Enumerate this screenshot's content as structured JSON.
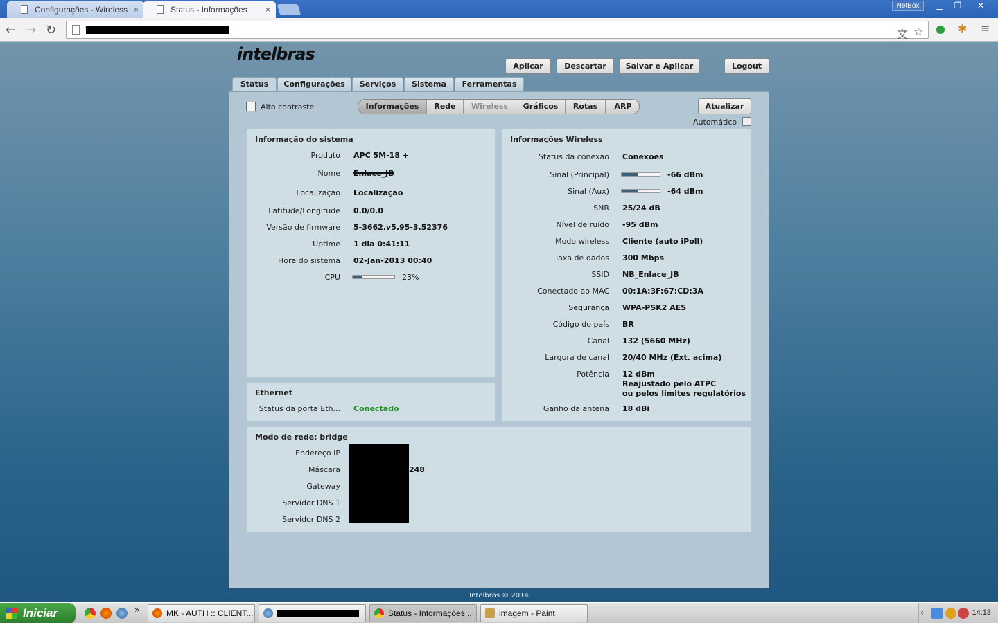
{
  "browser": {
    "tabs": [
      {
        "label": "Configurações - Wireless"
      },
      {
        "label": "Status - Informações"
      }
    ],
    "netbox": "NetBox",
    "url": "1",
    "close_glyph": "×"
  },
  "header": {
    "logo": "intelbras",
    "buttons": {
      "apply": "Aplicar",
      "discard": "Descartar",
      "save_apply": "Salvar e Aplicar",
      "logout": "Logout"
    }
  },
  "main_tabs": [
    "Status",
    "Configurações",
    "Serviços",
    "Sistema",
    "Ferramentas"
  ],
  "toolbar": {
    "high_contrast": "Alto contraste",
    "subtabs": [
      "Informações",
      "Rede",
      "Wireless",
      "Gráficos",
      "Rotas",
      "ARP"
    ],
    "refresh": "Atualizar",
    "automatic": "Automático"
  },
  "system": {
    "title": "Informação do sistema",
    "rows": [
      {
        "label": "Produto",
        "value": "APC 5M-18 +"
      },
      {
        "label": "Nome",
        "value": "Enlace_JB"
      },
      {
        "label": "Localização",
        "value": "Localização"
      },
      {
        "label": "Latitude/Longitude",
        "value": "0.0/0.0"
      },
      {
        "label": "Versão de firmware",
        "value": "5-3662.v5.95-3.52376"
      },
      {
        "label": "Uptime",
        "value": "1 dia 0:41:11"
      },
      {
        "label": "Hora do sistema",
        "value": "02-Jan-2013 00:40"
      },
      {
        "label": "CPU",
        "value": "23%"
      }
    ],
    "cpu_percent": 23
  },
  "ethernet": {
    "title": "Ethernet",
    "label": "Status da porta Eth...",
    "value": "Conectado"
  },
  "wireless": {
    "title": "Informações Wireless",
    "rows": [
      {
        "label": "Status da conexão",
        "value": "Conexões"
      },
      {
        "label": "Sinal (Principal)",
        "value": "-66 dBm"
      },
      {
        "label": "Sinal (Aux)",
        "value": "-64 dBm"
      },
      {
        "label": "SNR",
        "value": "25/24 dB"
      },
      {
        "label": "Nível de ruído",
        "value": "-95 dBm"
      },
      {
        "label": "Modo wireless",
        "value": "Cliente (auto iPoll)"
      },
      {
        "label": "Taxa de dados",
        "value": "300 Mbps"
      },
      {
        "label": "SSID",
        "value": "NB_Enlace_JB"
      },
      {
        "label": "Conectado ao MAC",
        "value": "00:1A:3F:67:CD:3A"
      },
      {
        "label": "Segurança",
        "value": "WPA-PSK2 AES"
      },
      {
        "label": "Código do país",
        "value": "BR"
      },
      {
        "label": "Canal",
        "value": "132 (5660 MHz)"
      },
      {
        "label": "Largura de canal",
        "value": "20/40 MHz (Ext. acima)"
      },
      {
        "label": "Potência",
        "value": "12 dBm",
        "value2": "Reajustado pelo ATPC",
        "value3": "ou pelos limites regulatórios"
      },
      {
        "label": "Ganho da antena",
        "value": "18 dBi"
      }
    ],
    "signal_main_fraction": 0.42,
    "signal_aux_fraction": 0.44
  },
  "network": {
    "title": "Modo de rede: bridge",
    "rows": [
      {
        "label": "Endereço IP"
      },
      {
        "label": "Máscara",
        "value": "248"
      },
      {
        "label": "Gateway"
      },
      {
        "label": "Servidor DNS 1"
      },
      {
        "label": "Servidor DNS 2"
      }
    ]
  },
  "footer": "Intelbras © 2014",
  "taskbar": {
    "start": "Iniciar",
    "tasks": [
      "MK - AUTH :: CLIENT...",
      "",
      "Status - Informações ...",
      "imagem - Paint"
    ],
    "clock": "14:13"
  }
}
